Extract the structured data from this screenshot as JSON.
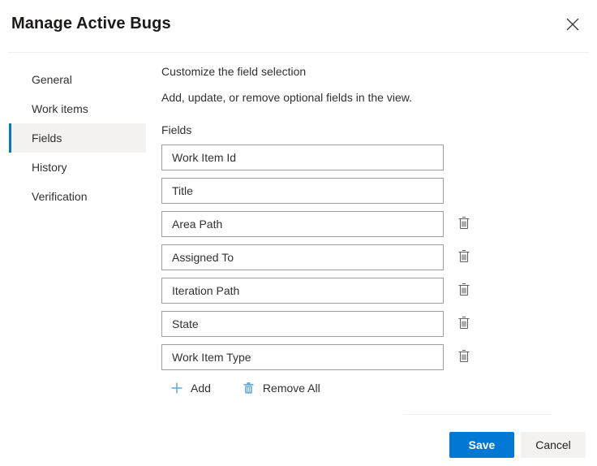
{
  "dialog": {
    "title": "Manage Active Bugs",
    "close_icon": "close-icon"
  },
  "sidebar": {
    "items": [
      {
        "label": "General",
        "selected": false
      },
      {
        "label": "Work items",
        "selected": false
      },
      {
        "label": "Fields",
        "selected": true
      },
      {
        "label": "History",
        "selected": false
      },
      {
        "label": "Verification",
        "selected": false
      }
    ]
  },
  "content": {
    "heading": "Customize the field selection",
    "subtext": "Add, update, or remove optional fields in the view.",
    "fields_label": "Fields",
    "fields": [
      {
        "value": "Work Item Id",
        "deletable": false,
        "delete_icon": "trash-icon"
      },
      {
        "value": "Title",
        "deletable": false,
        "delete_icon": "trash-icon"
      },
      {
        "value": "Area Path",
        "deletable": true,
        "delete_icon": "trash-icon"
      },
      {
        "value": "Assigned To",
        "deletable": true,
        "delete_icon": "trash-icon"
      },
      {
        "value": "Iteration Path",
        "deletable": true,
        "delete_icon": "trash-icon"
      },
      {
        "value": "State",
        "deletable": true,
        "delete_icon": "trash-icon"
      },
      {
        "value": "Work Item Type",
        "deletable": true,
        "delete_icon": "trash-icon"
      }
    ],
    "actions": {
      "add_label": "Add",
      "add_icon": "plus-icon",
      "remove_all_label": "Remove All",
      "remove_all_icon": "trash-icon"
    }
  },
  "footer": {
    "save_label": "Save",
    "cancel_label": "Cancel"
  },
  "colors": {
    "accent": "#0078d4",
    "accent_light": "#77aede",
    "selected_bg": "#f3f2f1",
    "border": "#a19f9d",
    "text": "#323130",
    "divider": "#f0f0f0"
  }
}
